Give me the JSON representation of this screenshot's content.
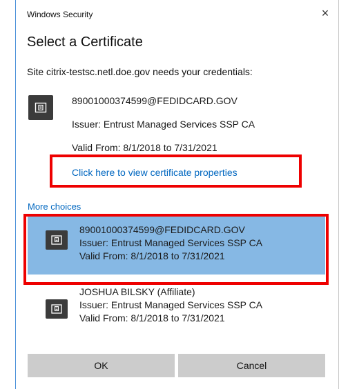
{
  "window": {
    "title": "Windows Security",
    "close_glyph": "×"
  },
  "dialog": {
    "heading": "Select a Certificate",
    "prompt": "Site citrix-testsc.netl.doe.gov needs your credentials:"
  },
  "certificate": {
    "name": "89001000374599@FEDIDCARD.GOV",
    "issuer": "Issuer: Entrust Managed Services SSP CA",
    "valid": "Valid From: 8/1/2018 to 7/31/2021",
    "properties_link": "Click here to view certificate properties"
  },
  "more_choices": {
    "label": "More choices",
    "options": [
      {
        "name": "89001000374599@FEDIDCARD.GOV",
        "issuer": "Issuer: Entrust Managed Services SSP CA",
        "valid": "Valid From: 8/1/2018 to 7/31/2021",
        "selected": true
      },
      {
        "name": "JOSHUA BILSKY (Affiliate)",
        "issuer": "Issuer: Entrust Managed Services SSP CA",
        "valid": "Valid From: 8/1/2018 to 7/31/2021",
        "selected": false
      }
    ]
  },
  "buttons": {
    "ok": "OK",
    "cancel": "Cancel"
  },
  "colors": {
    "selected_bg": "#86b8e4",
    "link": "#0067c0",
    "highlight_box": "#ee0000",
    "button_bg": "#cccccc"
  },
  "icons": {
    "certificate": "certificate-card-icon"
  }
}
